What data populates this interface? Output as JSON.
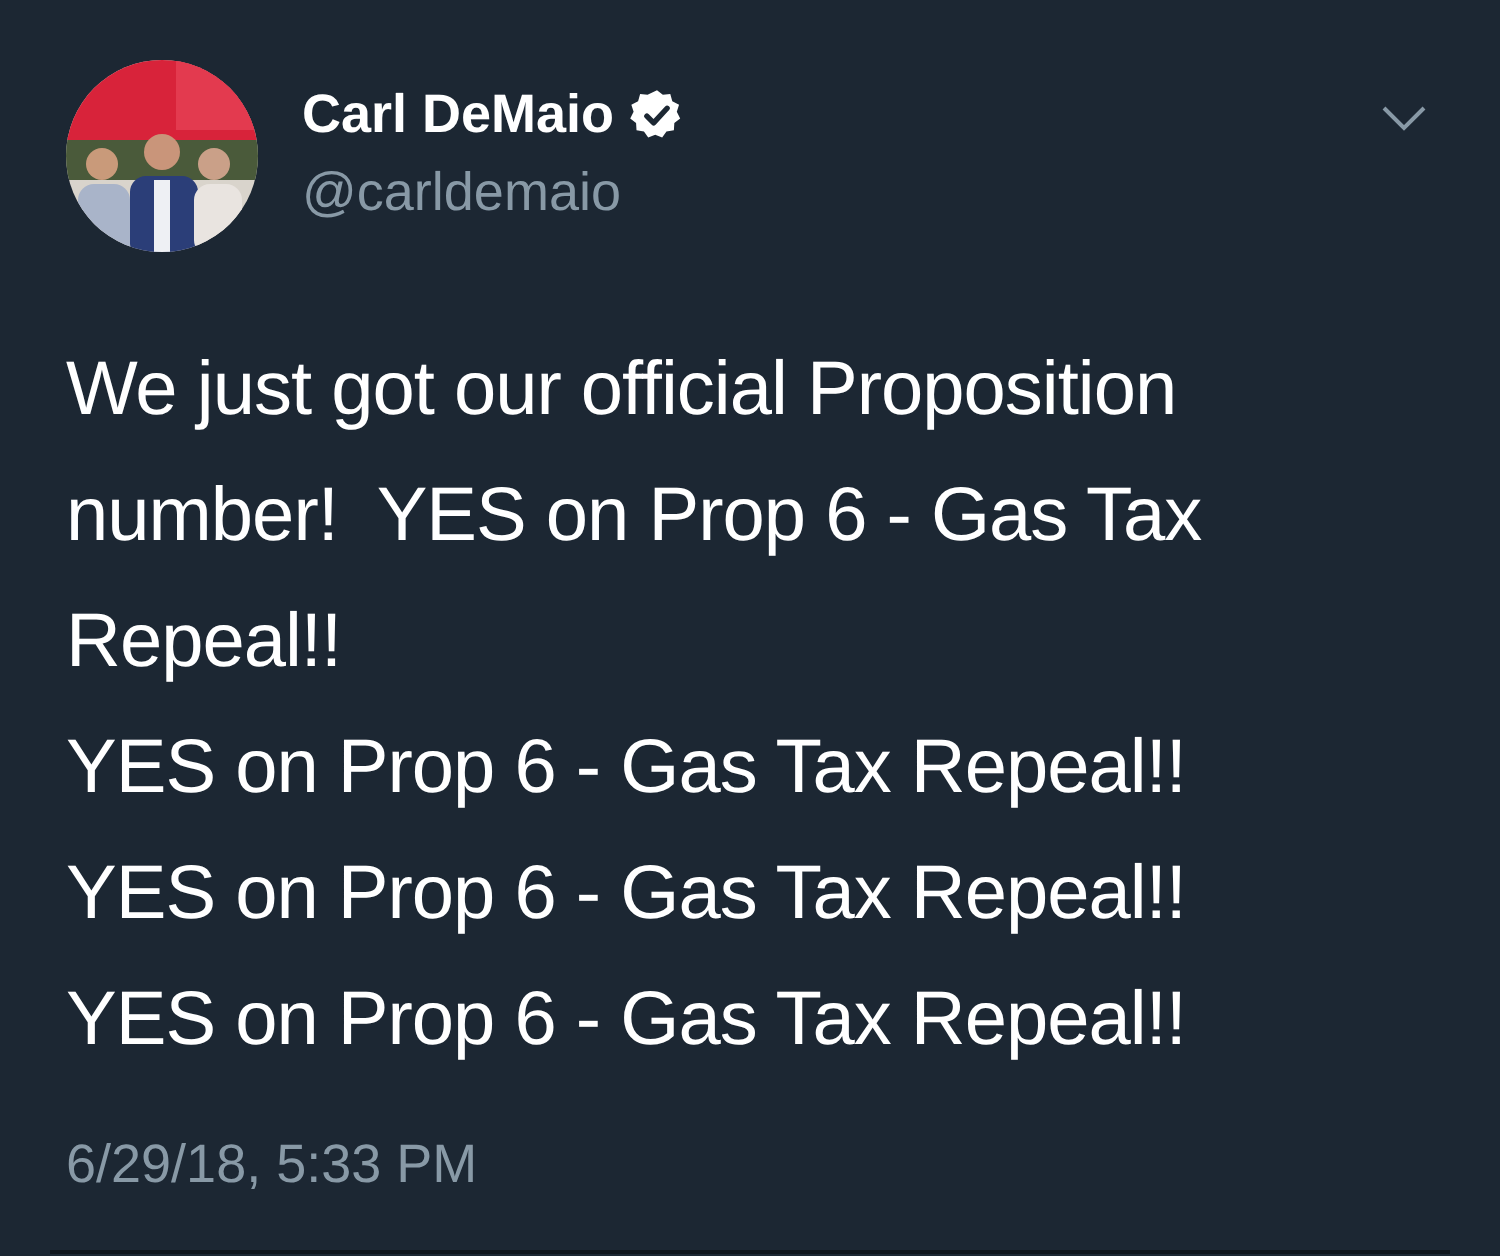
{
  "tweet": {
    "author": {
      "name": "Carl DeMaio",
      "verified": true,
      "handle": "@carldemaio"
    },
    "text": "We just got our official Proposition\nnumber!  YES on Prop 6 - Gas Tax\nRepeal!!\nYES on Prop 6 - Gas Tax Repeal!!\nYES on Prop 6 - Gas Tax Repeal!!\nYES on Prop 6 - Gas Tax Repeal!!",
    "timestamp": "6/29/18, 5:33 PM"
  }
}
